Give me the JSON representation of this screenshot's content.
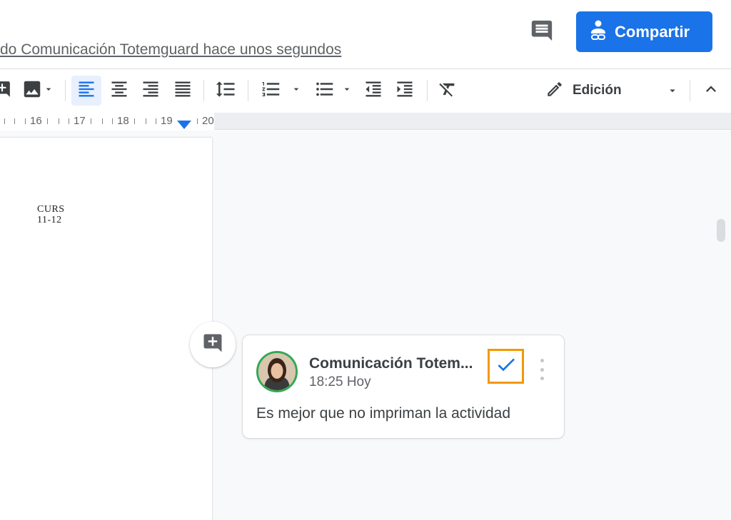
{
  "header": {
    "last_edit": "do Comunicación Totemguard hace unos segundos",
    "share_label": "Compartir"
  },
  "toolbar": {
    "edit_mode_label": "Edición"
  },
  "ruler": {
    "numbers": [
      "16",
      "17",
      "18",
      "19",
      "20"
    ]
  },
  "document": {
    "curs_line1": "CURS",
    "curs_line2": "11-12"
  },
  "comment": {
    "author": "Comunicación Totem...",
    "time": "18:25 Hoy",
    "text": "Es mejor que no impriman la actividad"
  },
  "colors": {
    "accent": "#1a73e8",
    "highlight_border": "#f29900",
    "avatar_ring": "#34a853"
  }
}
